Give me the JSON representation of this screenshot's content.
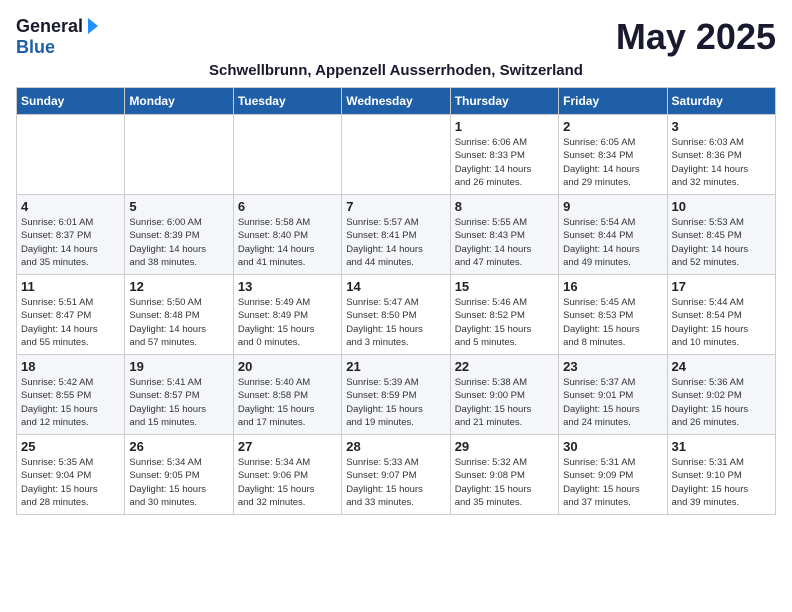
{
  "logo": {
    "general": "General",
    "blue": "Blue"
  },
  "title": "May 2025",
  "subtitle": "Schwellbrunn, Appenzell Ausserrhoden, Switzerland",
  "days_of_week": [
    "Sunday",
    "Monday",
    "Tuesday",
    "Wednesday",
    "Thursday",
    "Friday",
    "Saturday"
  ],
  "weeks": [
    [
      {
        "day": "",
        "info": ""
      },
      {
        "day": "",
        "info": ""
      },
      {
        "day": "",
        "info": ""
      },
      {
        "day": "",
        "info": ""
      },
      {
        "day": "1",
        "info": "Sunrise: 6:06 AM\nSunset: 8:33 PM\nDaylight: 14 hours\nand 26 minutes."
      },
      {
        "day": "2",
        "info": "Sunrise: 6:05 AM\nSunset: 8:34 PM\nDaylight: 14 hours\nand 29 minutes."
      },
      {
        "day": "3",
        "info": "Sunrise: 6:03 AM\nSunset: 8:36 PM\nDaylight: 14 hours\nand 32 minutes."
      }
    ],
    [
      {
        "day": "4",
        "info": "Sunrise: 6:01 AM\nSunset: 8:37 PM\nDaylight: 14 hours\nand 35 minutes."
      },
      {
        "day": "5",
        "info": "Sunrise: 6:00 AM\nSunset: 8:39 PM\nDaylight: 14 hours\nand 38 minutes."
      },
      {
        "day": "6",
        "info": "Sunrise: 5:58 AM\nSunset: 8:40 PM\nDaylight: 14 hours\nand 41 minutes."
      },
      {
        "day": "7",
        "info": "Sunrise: 5:57 AM\nSunset: 8:41 PM\nDaylight: 14 hours\nand 44 minutes."
      },
      {
        "day": "8",
        "info": "Sunrise: 5:55 AM\nSunset: 8:43 PM\nDaylight: 14 hours\nand 47 minutes."
      },
      {
        "day": "9",
        "info": "Sunrise: 5:54 AM\nSunset: 8:44 PM\nDaylight: 14 hours\nand 49 minutes."
      },
      {
        "day": "10",
        "info": "Sunrise: 5:53 AM\nSunset: 8:45 PM\nDaylight: 14 hours\nand 52 minutes."
      }
    ],
    [
      {
        "day": "11",
        "info": "Sunrise: 5:51 AM\nSunset: 8:47 PM\nDaylight: 14 hours\nand 55 minutes."
      },
      {
        "day": "12",
        "info": "Sunrise: 5:50 AM\nSunset: 8:48 PM\nDaylight: 14 hours\nand 57 minutes."
      },
      {
        "day": "13",
        "info": "Sunrise: 5:49 AM\nSunset: 8:49 PM\nDaylight: 15 hours\nand 0 minutes."
      },
      {
        "day": "14",
        "info": "Sunrise: 5:47 AM\nSunset: 8:50 PM\nDaylight: 15 hours\nand 3 minutes."
      },
      {
        "day": "15",
        "info": "Sunrise: 5:46 AM\nSunset: 8:52 PM\nDaylight: 15 hours\nand 5 minutes."
      },
      {
        "day": "16",
        "info": "Sunrise: 5:45 AM\nSunset: 8:53 PM\nDaylight: 15 hours\nand 8 minutes."
      },
      {
        "day": "17",
        "info": "Sunrise: 5:44 AM\nSunset: 8:54 PM\nDaylight: 15 hours\nand 10 minutes."
      }
    ],
    [
      {
        "day": "18",
        "info": "Sunrise: 5:42 AM\nSunset: 8:55 PM\nDaylight: 15 hours\nand 12 minutes."
      },
      {
        "day": "19",
        "info": "Sunrise: 5:41 AM\nSunset: 8:57 PM\nDaylight: 15 hours\nand 15 minutes."
      },
      {
        "day": "20",
        "info": "Sunrise: 5:40 AM\nSunset: 8:58 PM\nDaylight: 15 hours\nand 17 minutes."
      },
      {
        "day": "21",
        "info": "Sunrise: 5:39 AM\nSunset: 8:59 PM\nDaylight: 15 hours\nand 19 minutes."
      },
      {
        "day": "22",
        "info": "Sunrise: 5:38 AM\nSunset: 9:00 PM\nDaylight: 15 hours\nand 21 minutes."
      },
      {
        "day": "23",
        "info": "Sunrise: 5:37 AM\nSunset: 9:01 PM\nDaylight: 15 hours\nand 24 minutes."
      },
      {
        "day": "24",
        "info": "Sunrise: 5:36 AM\nSunset: 9:02 PM\nDaylight: 15 hours\nand 26 minutes."
      }
    ],
    [
      {
        "day": "25",
        "info": "Sunrise: 5:35 AM\nSunset: 9:04 PM\nDaylight: 15 hours\nand 28 minutes."
      },
      {
        "day": "26",
        "info": "Sunrise: 5:34 AM\nSunset: 9:05 PM\nDaylight: 15 hours\nand 30 minutes."
      },
      {
        "day": "27",
        "info": "Sunrise: 5:34 AM\nSunset: 9:06 PM\nDaylight: 15 hours\nand 32 minutes."
      },
      {
        "day": "28",
        "info": "Sunrise: 5:33 AM\nSunset: 9:07 PM\nDaylight: 15 hours\nand 33 minutes."
      },
      {
        "day": "29",
        "info": "Sunrise: 5:32 AM\nSunset: 9:08 PM\nDaylight: 15 hours\nand 35 minutes."
      },
      {
        "day": "30",
        "info": "Sunrise: 5:31 AM\nSunset: 9:09 PM\nDaylight: 15 hours\nand 37 minutes."
      },
      {
        "day": "31",
        "info": "Sunrise: 5:31 AM\nSunset: 9:10 PM\nDaylight: 15 hours\nand 39 minutes."
      }
    ]
  ]
}
